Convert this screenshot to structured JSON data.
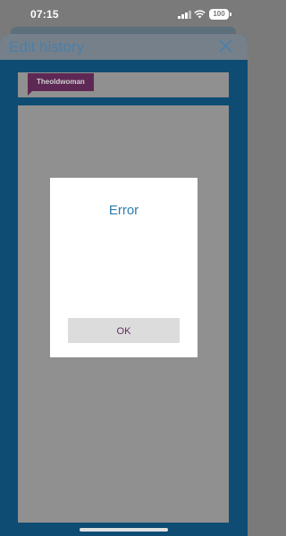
{
  "status_bar": {
    "time": "07:15",
    "battery": "100",
    "icons": [
      "signal-icon",
      "wifi-icon",
      "battery-icon"
    ]
  },
  "sheet": {
    "title": "Edit history",
    "close_icon": "close-icon",
    "author_tag": "Theoldwoman"
  },
  "dialog": {
    "title": "Error",
    "ok_label": "OK"
  },
  "colors": {
    "overlay": "#7a7a7a",
    "sheet_blue": "#0f4c73",
    "author_tag": "#5e2855",
    "dialog_title": "#2f7cae",
    "ok_text": "#6a2a66"
  }
}
